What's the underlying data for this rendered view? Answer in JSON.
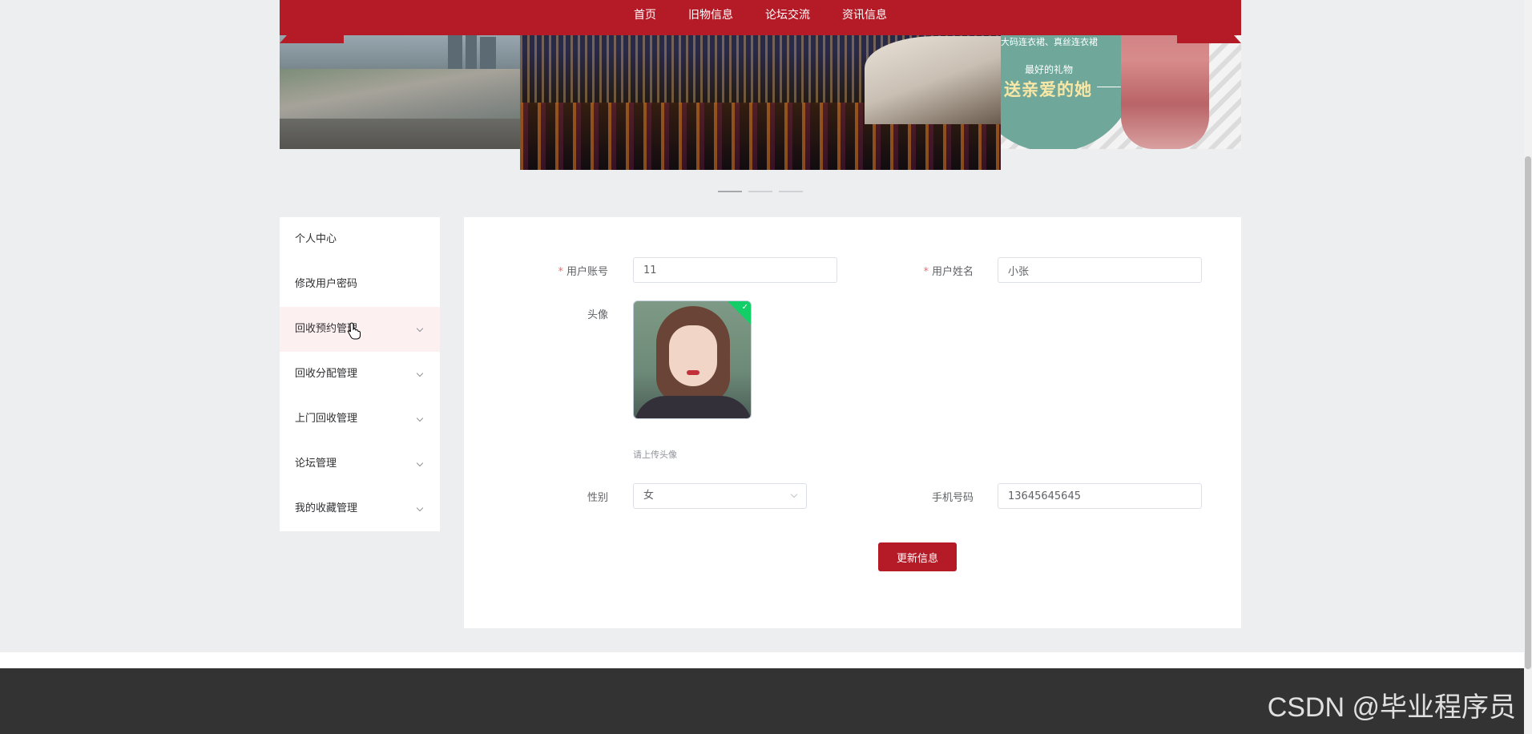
{
  "nav": {
    "items": [
      {
        "label": "首页"
      },
      {
        "label": "旧物信息"
      },
      {
        "label": "论坛交流"
      },
      {
        "label": "资讯信息"
      }
    ]
  },
  "banner": {
    "promo_small": "大码连衣裙、真丝连衣裙",
    "promo_gift": "最好的礼物",
    "promo_main": "送亲爱的她",
    "slide_count": 3,
    "active_slide": 0
  },
  "sidebar": {
    "items": [
      {
        "label": "个人中心",
        "has_submenu": false
      },
      {
        "label": "修改用户密码",
        "has_submenu": false
      },
      {
        "label": "回收预约管理",
        "has_submenu": true,
        "hovered": true
      },
      {
        "label": "回收分配管理",
        "has_submenu": true
      },
      {
        "label": "上门回收管理",
        "has_submenu": true
      },
      {
        "label": "论坛管理",
        "has_submenu": true
      },
      {
        "label": "我的收藏管理",
        "has_submenu": true
      }
    ]
  },
  "form": {
    "account": {
      "label": "用户账号",
      "value": "11",
      "required": true
    },
    "name": {
      "label": "用户姓名",
      "value": "小张",
      "required": true
    },
    "avatar": {
      "label": "头像",
      "hint": "请上传头像"
    },
    "gender": {
      "label": "性别",
      "value": "女"
    },
    "phone": {
      "label": "手机号码",
      "value": "13645645645"
    },
    "submit_label": "更新信息"
  },
  "watermark": "CSDN @毕业程序员",
  "colors": {
    "brand": "#b51b27",
    "success": "#13ce66",
    "footer": "#333333"
  }
}
